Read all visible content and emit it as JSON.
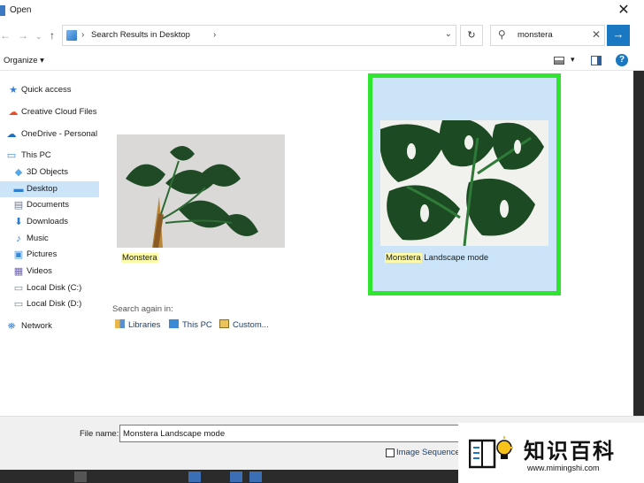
{
  "window": {
    "title": "Open",
    "close_glyph": "✕"
  },
  "nav": {
    "back_glyph": "←",
    "forward_glyph": "→",
    "recent_glyph": "⌄",
    "up_glyph": "↑",
    "address": "Search Results in Desktop",
    "address_sep": "›",
    "address_drop": "⌄",
    "refresh_glyph": "↻",
    "search_query": "monstera",
    "search_clear": "✕",
    "go_glyph": "→"
  },
  "toolbar": {
    "organize_label": "Organize ▾",
    "view_drop": "▾",
    "help_label": "?"
  },
  "sidebar": {
    "items": [
      {
        "label": "Quick access",
        "icon": "star-icon",
        "glyph": "★",
        "color": "#3b7fd0"
      },
      {
        "label": "Creative Cloud Files",
        "icon": "creative-cloud-icon",
        "glyph": "☁",
        "color": "#e2512a"
      },
      {
        "label": "OneDrive - Personal",
        "icon": "onedrive-icon",
        "glyph": "☁",
        "color": "#1a6fc4"
      },
      {
        "label": "This PC",
        "icon": "computer-icon",
        "glyph": "▭",
        "color": "#3a8ad6"
      },
      {
        "label": "3D Objects",
        "icon": "cube-icon",
        "glyph": "◆",
        "color": "#56a7e8"
      },
      {
        "label": "Desktop",
        "icon": "desktop-icon",
        "glyph": "▬",
        "color": "#2c7fd1"
      },
      {
        "label": "Documents",
        "icon": "document-icon",
        "glyph": "▤",
        "color": "#6c7a89"
      },
      {
        "label": "Downloads",
        "icon": "download-icon",
        "glyph": "⬇",
        "color": "#2b7ad0"
      },
      {
        "label": "Music",
        "icon": "music-icon",
        "glyph": "♪",
        "color": "#2b7ad0"
      },
      {
        "label": "Pictures",
        "icon": "picture-icon",
        "glyph": "▣",
        "color": "#3c8bd4"
      },
      {
        "label": "Videos",
        "icon": "video-icon",
        "glyph": "▦",
        "color": "#6b5fb5"
      },
      {
        "label": "Local Disk (C:)",
        "icon": "disk-icon",
        "glyph": "▭",
        "color": "#7a8896"
      },
      {
        "label": "Local Disk (D:)",
        "icon": "disk-icon",
        "glyph": "▭",
        "color": "#7a8896"
      },
      {
        "label": "Network",
        "icon": "network-icon",
        "glyph": "⛯",
        "color": "#2b7ad0"
      }
    ],
    "selected_index": 5
  },
  "results": {
    "files": [
      {
        "name_match": "Monstera",
        "name_rest": ""
      },
      {
        "name_match": "Monstera",
        "name_rest": " Landscape mode",
        "selected": true
      }
    ],
    "search_again_label": "Search again in:",
    "search_again_items": [
      {
        "label": "Libraries",
        "icon": "library-icon"
      },
      {
        "label": "This PC",
        "icon": "computer-icon"
      },
      {
        "label": "Custom...",
        "icon": "folder-icon"
      }
    ]
  },
  "footer": {
    "file_name_label": "File name:",
    "file_name_value": "Monstera Landscape mode",
    "image_sequence_label": "Image Sequence"
  },
  "watermark": {
    "text": "知识百科",
    "url": "www.mimingshi.com"
  },
  "colors": {
    "selection_border": "#2ee62e",
    "selection_fill": "#cce4f7",
    "accent": "#1a78c2",
    "highlight": "#fdfbaa"
  }
}
